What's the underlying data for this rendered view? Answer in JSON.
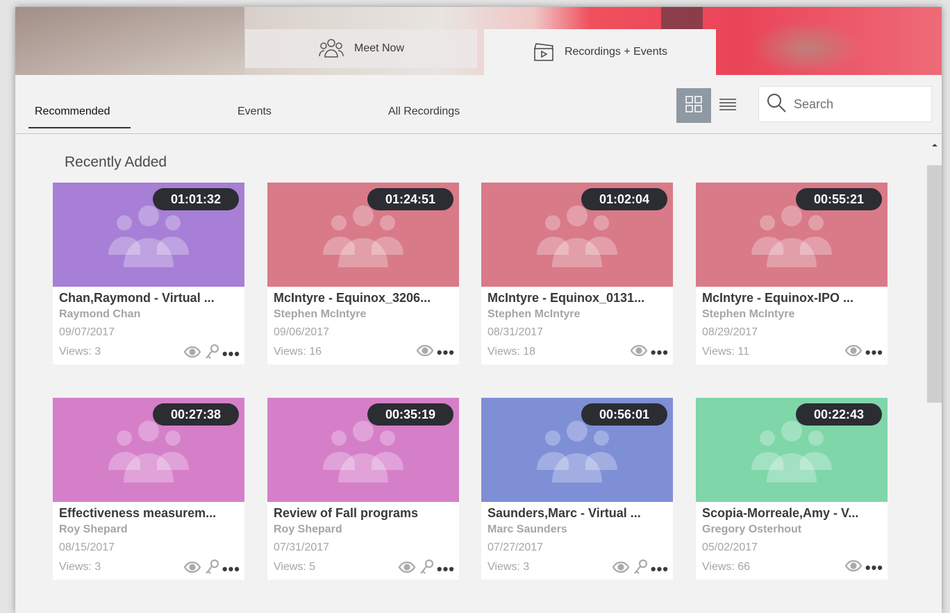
{
  "header": {
    "tabs": [
      {
        "label": "Meet Now",
        "icon": "people-icon"
      },
      {
        "label": "Recordings + Events",
        "icon": "clapperboard-icon"
      }
    ]
  },
  "subnav": {
    "tabs": [
      "Recommended",
      "Events",
      "All Recordings"
    ],
    "active": "Recommended",
    "view_modes": [
      "grid-view-icon",
      "list-view-icon"
    ],
    "search_placeholder": "Search"
  },
  "section": {
    "title": "Recently Added"
  },
  "recordings": [
    {
      "duration": "01:01:32",
      "title": "Chan,Raymond - Virtual ...",
      "author": "Raymond Chan",
      "date": "09/07/2017",
      "views": "Views: 3",
      "locked": true,
      "color": "#a77fd6"
    },
    {
      "duration": "01:24:51",
      "title": "McIntyre - Equinox_3206...",
      "author": "Stephen McIntyre",
      "date": "09/06/2017",
      "views": "Views: 16",
      "locked": false,
      "color": "#d97a88"
    },
    {
      "duration": "01:02:04",
      "title": "McIntyre - Equinox_0131...",
      "author": "Stephen McIntyre",
      "date": "08/31/2017",
      "views": "Views: 18",
      "locked": false,
      "color": "#d97a88"
    },
    {
      "duration": "00:55:21",
      "title": "McIntyre - Equinox-IPO ...",
      "author": "Stephen McIntyre",
      "date": "08/29/2017",
      "views": "Views: 11",
      "locked": false,
      "color": "#d97a88"
    },
    {
      "duration": "00:27:38",
      "title": "Effectiveness measurem...",
      "author": "Roy Shepard",
      "date": "08/15/2017",
      "views": "Views: 3",
      "locked": true,
      "color": "#d57fc9"
    },
    {
      "duration": "00:35:19",
      "title": "Review of Fall programs",
      "author": "Roy Shepard",
      "date": "07/31/2017",
      "views": "Views: 5",
      "locked": true,
      "color": "#d57fc9"
    },
    {
      "duration": "00:56:01",
      "title": "Saunders,Marc - Virtual ...",
      "author": "Marc Saunders",
      "date": "07/27/2017",
      "views": "Views: 3",
      "locked": true,
      "color": "#7f8fd6"
    },
    {
      "duration": "00:22:43",
      "title": "Scopia-Morreale,Amy - V...",
      "author": "Gregory Osterhout",
      "date": "05/02/2017",
      "views": "Views: 66",
      "locked": false,
      "color": "#7fd6a9"
    }
  ]
}
